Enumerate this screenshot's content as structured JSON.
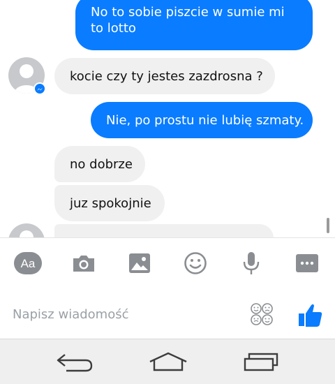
{
  "conversation": {
    "messages": [
      {
        "direction": "outgoing",
        "text": "No to sobie piszcie w sumie mi to lotto"
      },
      {
        "direction": "incoming",
        "text": "kocie czy ty jestes zazdrosna ?"
      },
      {
        "direction": "outgoing",
        "text": "Nie, po prostu nie lubię szmaty."
      },
      {
        "direction": "incoming",
        "text": "no dobrze"
      },
      {
        "direction": "incoming",
        "text": "juz spokojnie"
      },
      {
        "direction": "incoming",
        "text": ""
      }
    ]
  },
  "composer": {
    "placeholder": "Napisz wiadomość",
    "tools": [
      "text-format-icon",
      "camera-icon",
      "image-icon",
      "emoji-icon",
      "microphone-icon",
      "more-icon"
    ],
    "aa_label": "Aa"
  },
  "colors": {
    "outgoing_bubble": "#0a7cff",
    "incoming_bubble": "#f0f0f0",
    "toolbar_icon": "#8a8d91",
    "like": "#0a7cff"
  },
  "navigation": [
    "back-icon",
    "home-icon",
    "recent-apps-icon"
  ]
}
